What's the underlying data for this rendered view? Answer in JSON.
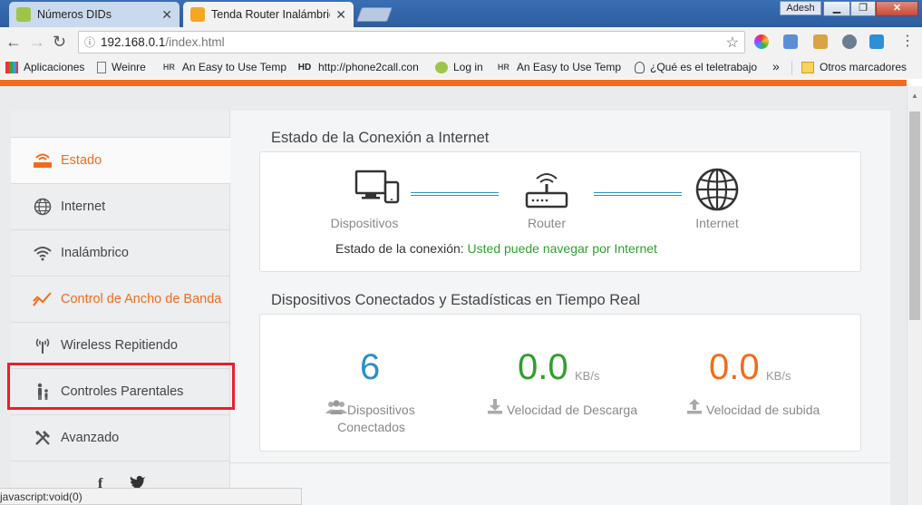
{
  "browser": {
    "tabs": [
      {
        "title": "Números DIDs",
        "active": false
      },
      {
        "title": "Tenda Router Inalámbric",
        "active": true
      }
    ],
    "profile": "Adesh",
    "url_host": "192.168.0.1",
    "url_path": "/index.html",
    "bookmarks": [
      {
        "label": "Aplicaciones",
        "icon": "apps-grid-icon"
      },
      {
        "label": "Weinre",
        "icon": "page-icon"
      },
      {
        "label": "An Easy to Use Temp",
        "icon": "hr-icon"
      },
      {
        "label": "http://phone2call.con",
        "icon": "hd-icon"
      },
      {
        "label": "Log in",
        "icon": "android-icon"
      },
      {
        "label": "An Easy to Use Temp",
        "icon": "hr-icon"
      },
      {
        "label": "¿Qué es el teletrabajo",
        "icon": "bulb-icon"
      }
    ],
    "more_bookmarks": "»",
    "other_bookmarks": "Otros marcadores",
    "status_text": "javascript:void(0)"
  },
  "sidebar": {
    "items": [
      {
        "label": "Estado",
        "icon": "router-status-icon",
        "active": true
      },
      {
        "label": "Internet",
        "icon": "globe-icon",
        "active": false
      },
      {
        "label": "Inalámbrico",
        "icon": "wifi-icon",
        "active": false
      },
      {
        "label": "Control de Ancho de Banda",
        "icon": "bandwidth-chart-icon",
        "active": false
      },
      {
        "label": "Wireless Repitiendo",
        "icon": "antenna-icon",
        "active": false
      },
      {
        "label": "Controles Parentales",
        "icon": "family-icon",
        "active": false
      },
      {
        "label": "Avanzado",
        "icon": "tools-icon",
        "active": false
      }
    ],
    "social": [
      "f",
      "twitter"
    ]
  },
  "connection": {
    "title": "Estado de la Conexión a Internet",
    "devices_label": "Dispositivos",
    "router_label": "Router",
    "internet_label": "Internet",
    "status_label": "Estado de la conexión:",
    "status_value": "Usted puede navegar por Internet",
    "status_color": "#2ea02e"
  },
  "stats": {
    "title": "Dispositivos Conectados y Estadísticas en Tiempo Real",
    "devices_count": "6",
    "devices_label_1": "Dispositivos",
    "devices_label_2": "Conectados",
    "download_value": "0.0",
    "download_unit": "KB/s",
    "download_label": "Velocidad de Descarga",
    "upload_value": "0.0",
    "upload_unit": "KB/s",
    "upload_label": "Velocidad de subida",
    "colors": {
      "devices": "#2d8fc4",
      "download": "#2ea02e",
      "upload": "#f26c1d"
    }
  },
  "theme": {
    "accent": "#f26c1d",
    "highlight_box": "#e8202a"
  }
}
